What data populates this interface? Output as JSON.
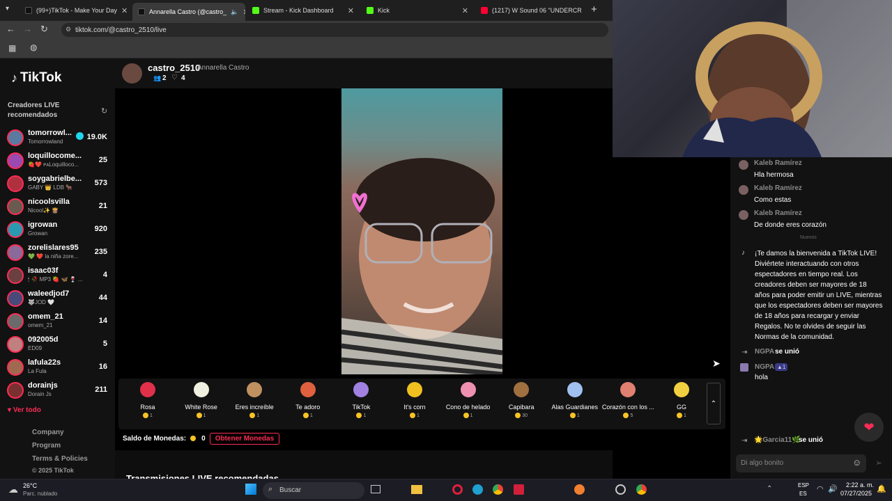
{
  "browser": {
    "tabs": [
      {
        "title": "(99+)TikTok - Make Your Day",
        "color": "#222222"
      },
      {
        "title": "Annarella Castro (@castro_",
        "color": "#222222",
        "active": true
      },
      {
        "title": "Stream - Kick Dashboard",
        "color": "#53fc18"
      },
      {
        "title": "Kick",
        "color": "#53fc18"
      },
      {
        "title": "(1217) W Sound 06 \"UNDERCR",
        "color": "#ff0033"
      }
    ],
    "new_tab": "+",
    "url": "tiktok.com/@castro_2510/live"
  },
  "sidebar": {
    "logo": "TikTok",
    "live_heading": "Creadores LIVE recomendados",
    "creators": [
      {
        "name": "tomorrowl...",
        "sub": "Tomorrowland",
        "count": "19.0K",
        "color": "#5a7aa0"
      },
      {
        "name": "loquillocome...",
        "sub": "🍓❤️ ᴘᴀLoquilloco...",
        "count": "25",
        "color": "#9a4ab0"
      },
      {
        "name": "soygabrielbe...",
        "sub": "GABY 👑 LDB 🐂",
        "count": "573",
        "color": "#b03040"
      },
      {
        "name": "nicoolsvilla",
        "sub": "Nicool✨ 👸🏽",
        "count": "21",
        "color": "#6a5a50"
      },
      {
        "name": "igrowan",
        "sub": "Growan",
        "count": "920",
        "color": "#2a9ab0"
      },
      {
        "name": "zorelislares95",
        "sub": "💚 ❤️ la niña zore...",
        "count": "235",
        "color": "#8a6a9a"
      },
      {
        "name": "isaac03f",
        "sub": "🕯 🥀 MP3 🍓 🦋 🍷 ...",
        "count": "4",
        "color": "#6a4040"
      },
      {
        "name": "waleedjod7",
        "sub": "🐺JOD 🤍",
        "count": "44",
        "color": "#4a4a7a"
      },
      {
        "name": "omem_21",
        "sub": "omem_21",
        "count": "14",
        "color": "#6a6a6a"
      },
      {
        "name": "092005d",
        "sub": "ED09",
        "count": "5",
        "color": "#c08080"
      },
      {
        "name": "lafula22s",
        "sub": "La Fula",
        "count": "16",
        "color": "#a06a50"
      },
      {
        "name": "dorainjs",
        "sub": "Dorain Js",
        "count": "211",
        "color": "#7a3030"
      }
    ],
    "see_all": "Ver todo",
    "footer": [
      "Company",
      "Program",
      "Terms & Policies"
    ],
    "copyright": "© 2025 TikTok"
  },
  "streamer": {
    "handle": "castro_2510",
    "name": "Annarella Castro",
    "viewers": "2",
    "likes": "4"
  },
  "gifts": [
    {
      "name": "Rosa",
      "price": "1",
      "color": "#e0304a"
    },
    {
      "name": "White Rose",
      "price": "1",
      "color": "#f0f0e0"
    },
    {
      "name": "Eres increíble",
      "price": "1",
      "color": "#c09060"
    },
    {
      "name": "Te adoro",
      "price": "1",
      "color": "#e06040"
    },
    {
      "name": "TikTok",
      "price": "1",
      "color": "#a080e0"
    },
    {
      "name": "It's corn",
      "price": "1",
      "color": "#f0c020"
    },
    {
      "name": "Cono de helado",
      "price": "1",
      "color": "#f090b0"
    },
    {
      "name": "Capibara",
      "price": "30",
      "color": "#a07040"
    },
    {
      "name": "Alas Guardianes",
      "price": "1",
      "color": "#a0c0f0"
    },
    {
      "name": "Corazón con los ...",
      "price": "5",
      "color": "#e08070"
    },
    {
      "name": "GG",
      "price": "1",
      "color": "#f0d040"
    }
  ],
  "coins": {
    "label": "Saldo de Monedas:",
    "value": "0",
    "button": "Obtener Monedas"
  },
  "recommended_heading": "Transmisiones LIVE recomendadas",
  "chat": {
    "messages": [
      {
        "user": "Kaleb Ramírez",
        "text": "Hla hermosa"
      },
      {
        "user": "Kaleb Ramírez",
        "text": "Como estas"
      },
      {
        "user": "Kaleb Ramírez",
        "text": "De donde eres corazón"
      }
    ],
    "divider": "Nuevos",
    "welcome": "¡Te damos la bienvenida a TikTok LIVE! Diviértete interactuando con otros espectadores en tiempo real. Los creadores deben ser mayores de 18 años para poder emitir un LIVE, mientras que los espectadores deben ser mayores de 18 años para recargar y enviar Regalos. No te olvides de seguir las Normas de la comunidad.",
    "joined_user": "NGPA",
    "joined_text": "se unió",
    "ngpa_badge": "1",
    "ngpa_msg": "hola",
    "joined2_user": "🌟Garcia11🌿",
    "joined2_text": "se unió",
    "placeholder": "Di algo bonito"
  },
  "taskbar": {
    "temp": "26°C",
    "weather": "Parc. nublado",
    "search": "Buscar",
    "lang1": "ESP",
    "lang2": "ES",
    "time": "2:22 a. m.",
    "date": "07/27/2025"
  }
}
